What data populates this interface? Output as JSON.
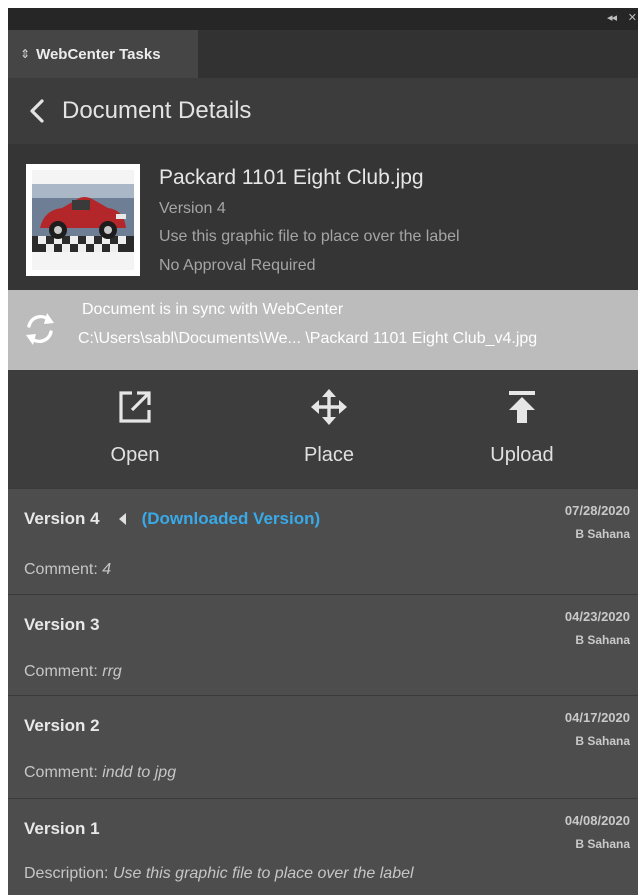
{
  "chrome": {
    "collapse_icon": "collapse-arrows",
    "close_icon": "close"
  },
  "tab": {
    "label": "WebCenter Tasks",
    "icon": "chevron-updown"
  },
  "header": {
    "back_icon": "chevron-left",
    "title": "Document Details"
  },
  "document": {
    "name": "Packard 1101 Eight Club.jpg",
    "version": "Version 4",
    "description": "Use this graphic file to place over the label",
    "approval": "No Approval Required",
    "thumbnail": "car-thumbnail"
  },
  "sync": {
    "icon": "sync",
    "title": "Document is in sync with WebCenter",
    "path": "C:\\Users\\sabl\\Documents\\We... \\Packard 1101 Eight Club_v4.jpg"
  },
  "actions": [
    {
      "label": "Open",
      "icon": "open-external"
    },
    {
      "label": "Place",
      "icon": "move-arrows"
    },
    {
      "label": "Upload",
      "icon": "upload-arrow"
    }
  ],
  "versions": [
    {
      "title": "Version 4",
      "downloaded_label": "(Downloaded Version)",
      "date": "07/28/2020",
      "author": "B Sahana",
      "comment_label": "Comment:",
      "comment_value": "4"
    },
    {
      "title": "Version 3",
      "date": "04/23/2020",
      "author": "B Sahana",
      "comment_label": "Comment:",
      "comment_value": "rrg"
    },
    {
      "title": "Version 2",
      "date": "04/17/2020",
      "author": "B Sahana",
      "comment_label": "Comment:",
      "comment_value": "indd to jpg"
    },
    {
      "title": "Version 1",
      "date": "04/08/2020",
      "author": "B Sahana",
      "comment_label": "Description:",
      "comment_value": "Use this graphic file to place over the label"
    }
  ],
  "colors": {
    "accent": "#39a9e8",
    "panel": "#4a4a4a",
    "sync_bar": "#bcbcbc"
  }
}
